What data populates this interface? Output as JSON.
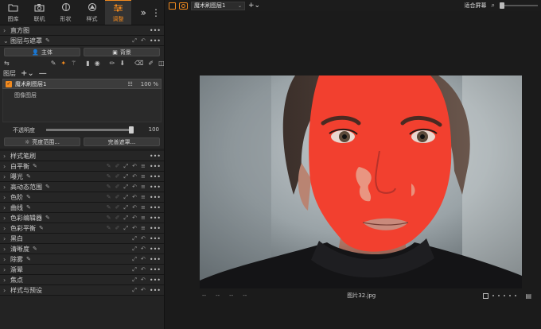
{
  "tabs": [
    {
      "label": "图库",
      "icon": "folder-icon"
    },
    {
      "label": "联机",
      "icon": "camera-icon"
    },
    {
      "label": "形状",
      "icon": "shape-icon"
    },
    {
      "label": "样式",
      "icon": "style-icon"
    },
    {
      "label": "调整",
      "icon": "adjust-icon",
      "active": true
    }
  ],
  "sections_top": [
    {
      "label": "直方图"
    },
    {
      "label": "图层与遮罩"
    }
  ],
  "mask_buttons": {
    "subject": "主体",
    "background": "背景"
  },
  "layers": {
    "header": "图层",
    "item_name": "魔术刷图层1",
    "item_opacity": "100 %",
    "body_label": "图像图层",
    "opacity_label": "不透明度",
    "opacity_value": "100",
    "opacity_level": 1.0,
    "refine_button": "亮度范围...",
    "finish_button": "完善遮罩..."
  },
  "tools_rows": [
    {
      "label": "样式笔刷",
      "pen": false
    },
    {
      "label": "白平衡",
      "pen": true
    },
    {
      "label": "曝光",
      "pen": true
    },
    {
      "label": "高动态范围",
      "pen": true
    },
    {
      "label": "色阶",
      "pen": true
    },
    {
      "label": "曲线",
      "pen": true
    },
    {
      "label": "色彩编辑器",
      "pen": true
    },
    {
      "label": "色彩平衡",
      "pen": true
    },
    {
      "label": "黑白",
      "pen": false
    },
    {
      "label": "清晰度",
      "pen": true
    },
    {
      "label": "除雾",
      "pen": true
    },
    {
      "label": "渐晕",
      "pen": false
    },
    {
      "label": "焦点",
      "pen": false
    },
    {
      "label": "样式与预设",
      "pen": false
    }
  ],
  "topbar": {
    "layer_select": "魔术刷图层1",
    "zoom_label": "适合屏幕"
  },
  "viewer": {
    "filename": "图片32.jpg",
    "meta": [
      "--",
      "--",
      "--",
      "--"
    ]
  },
  "colors": {
    "accent": "#f28a1e",
    "mask": "#f2402f"
  }
}
